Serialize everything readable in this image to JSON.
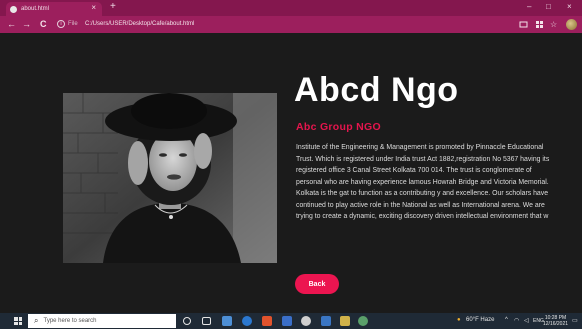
{
  "browser": {
    "tab_title": "about.html",
    "tab_close": "×",
    "new_tab": "+",
    "minimize": "–",
    "maximize": "□",
    "close": "×",
    "back": "←",
    "forward": "→",
    "reload": "C",
    "file_label": "File",
    "url": "C:/Users/USER/Desktop/Cafe/about.html",
    "accent": "#9c1f5d"
  },
  "page": {
    "heading": "Abcd Ngo",
    "subheading": "Abc Group NGO",
    "description": "Institute of the Engineering & Management is promoted by Pinnaccle Educational Trust. Which is registered under India trust Act 1882,registration No 5367 having its registered office 3 Canal Street Kolkata 700 014. The trust is conglomerate of personal who are having experience lamous Howrah Bridge and Victoria Memorial. Kolkata is the gat to function as a contributing y and excellence. Our scholars have continued to play active role in the National as well as International arena. We are trying to create a dynamic, exciting discovery driven intellectual environment that w",
    "back_button": "Back",
    "accent": "#ec1550"
  },
  "taskbar": {
    "search_placeholder": "Type here to search",
    "weather": "60°F Haze",
    "time": "10:28 PM",
    "date": "12/16/2021",
    "lang": "ENG"
  }
}
